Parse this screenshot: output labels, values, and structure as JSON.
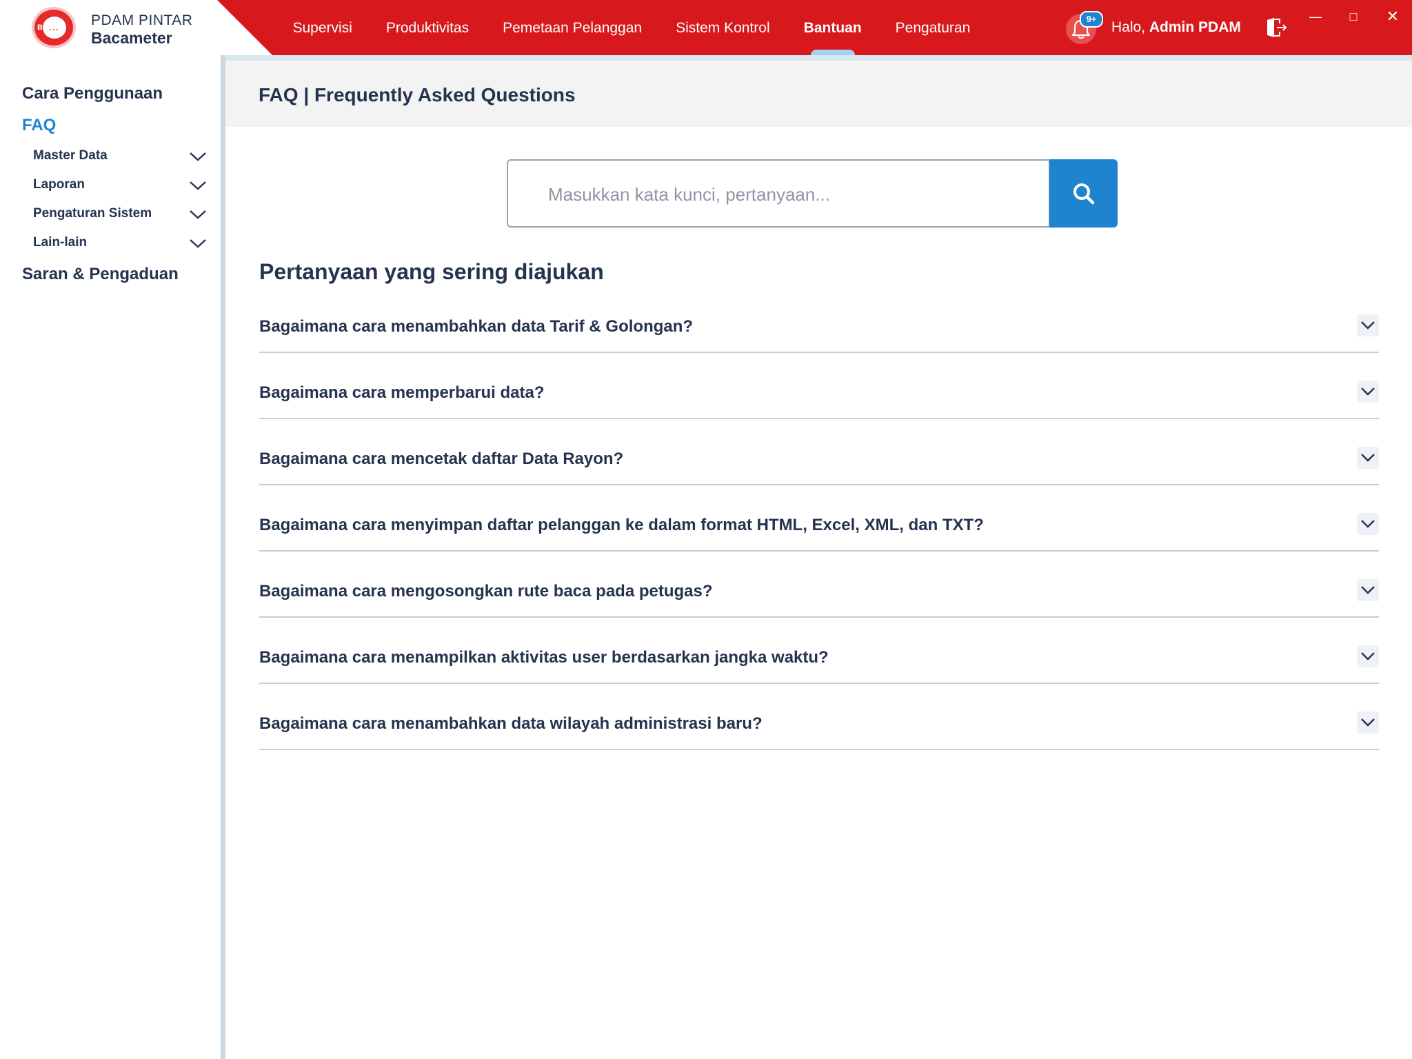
{
  "app": {
    "brand_title": "PDAM PINTAR",
    "brand_subtitle": "Bacameter",
    "logo_text": "Bm"
  },
  "nav": {
    "items": [
      {
        "label": "Supervisi",
        "active": false
      },
      {
        "label": "Produktivitas",
        "active": false
      },
      {
        "label": "Pemetaan Pelanggan",
        "active": false
      },
      {
        "label": "Sistem Kontrol",
        "active": false
      },
      {
        "label": "Bantuan",
        "active": true
      },
      {
        "label": "Pengaturan",
        "active": false
      }
    ]
  },
  "user": {
    "greeting_prefix": "Halo,",
    "name": "Admin PDAM",
    "notification_badge": "9+"
  },
  "sidebar": {
    "cara_penggunaan": "Cara Penggunaan",
    "faq": "FAQ",
    "sub_items": [
      {
        "label": "Master Data"
      },
      {
        "label": "Laporan"
      },
      {
        "label": "Pengaturan Sistem"
      },
      {
        "label": "Lain-lain"
      }
    ],
    "saran": "Saran & Pengaduan"
  },
  "page": {
    "title": "FAQ | Frequently Asked Questions",
    "search_placeholder": "Masukkan kata kunci, pertanyaan...",
    "section_title": "Pertanyaan yang sering diajukan"
  },
  "faq": [
    {
      "question": "Bagaimana cara menambahkan data Tarif & Golongan?"
    },
    {
      "question": "Bagaimana cara memperbarui data?"
    },
    {
      "question": "Bagaimana cara mencetak daftar Data Rayon?"
    },
    {
      "question": "Bagaimana cara menyimpan daftar pelanggan ke dalam format HTML, Excel, XML, dan TXT?"
    },
    {
      "question": "Bagaimana cara mengosongkan rute baca pada petugas?"
    },
    {
      "question": "Bagaimana cara menampilkan aktivitas user berdasarkan jangka waktu?"
    },
    {
      "question": "Bagaimana cara menambahkan data wilayah administrasi baru?"
    }
  ],
  "colors": {
    "topbar": "#d7191d",
    "accent": "#1f84d0",
    "text": "#25334f"
  }
}
